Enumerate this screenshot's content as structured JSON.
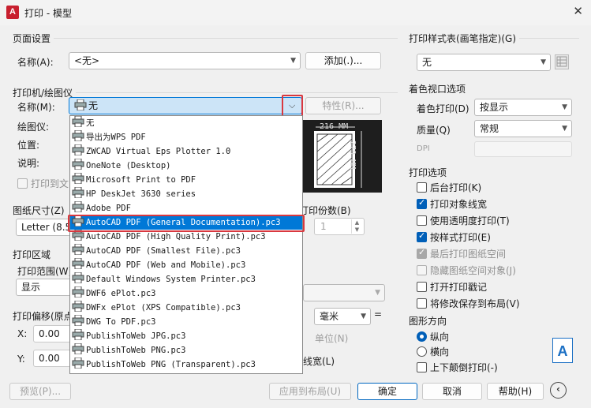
{
  "window": {
    "title": "打印 - 模型",
    "app_icon": "A",
    "close": "✕"
  },
  "page_setup": {
    "group": "页面设置",
    "name_label": "名称(A):",
    "name_value": "<无>",
    "add_button": "添加(.)..."
  },
  "printer": {
    "group": "打印机/绘图仪",
    "name_label": "名称(M):",
    "name_value": "无",
    "props_button": "特性(R)...",
    "plotter_label": "绘图仪:",
    "location_label": "位置:",
    "desc_label": "说明:",
    "print_to_file": "打印到文",
    "dropdown_items": [
      "无",
      "导出为WPS PDF",
      "ZWCAD Virtual Eps Plotter 1.0",
      "OneNote (Desktop)",
      "Microsoft Print to PDF",
      "HP DeskJet 3630 series",
      "Adobe PDF",
      "AutoCAD PDF (General Documentation).pc3",
      "AutoCAD PDF (High Quality Print).pc3",
      "AutoCAD PDF (Smallest File).pc3",
      "AutoCAD PDF (Web and Mobile).pc3",
      "Default Windows System Printer.pc3",
      "DWF6 ePlot.pc3",
      "DWFx ePlot (XPS Compatible).pc3",
      "DWG To PDF.pc3",
      "PublishToWeb JPG.pc3",
      "PublishToWeb PNG.pc3",
      "PublishToWeb PNG (Transparent).pc3"
    ],
    "selected_index": 7
  },
  "preview": {
    "width_label": "216 MM",
    "height_label": "279 MM"
  },
  "paper": {
    "group": "图纸尺寸(Z)",
    "value": "Letter (8.5"
  },
  "copies": {
    "group": "打印份数(B)",
    "value": "1"
  },
  "plot_area": {
    "group": "打印区域",
    "range_label": "打印范围(W)",
    "range_value": "显示"
  },
  "offset": {
    "group": "打印偏移(原点",
    "x_label": "X:",
    "x_value": "0.00",
    "y_label": "Y:",
    "y_value": "0.00",
    "unit_value": "毫米",
    "eq": "=",
    "unit_label": "单位(N)",
    "lineweight": "线宽(L)"
  },
  "style_table": {
    "group": "打印样式表(画笔指定)(G)",
    "value": "无"
  },
  "shaded": {
    "group": "着色视口选项",
    "shade_label": "着色打印(D)",
    "shade_value": "按显示",
    "quality_label": "质量(Q)",
    "quality_value": "常规",
    "dpi_label": "DPI"
  },
  "options": {
    "group": "打印选项",
    "items": [
      {
        "label": "后台打印(K)",
        "checked": false,
        "disabled": false
      },
      {
        "label": "打印对象线宽",
        "checked": true,
        "disabled": false
      },
      {
        "label": "使用透明度打印(T)",
        "checked": false,
        "disabled": false
      },
      {
        "label": "按样式打印(E)",
        "checked": true,
        "disabled": false
      },
      {
        "label": "最后打印图纸空间",
        "checked": true,
        "disabled": true
      },
      {
        "label": "隐藏图纸空间对象(J)",
        "checked": false,
        "disabled": true
      },
      {
        "label": "打开打印戳记",
        "checked": false,
        "disabled": false
      },
      {
        "label": "将修改保存到布局(V)",
        "checked": false,
        "disabled": false
      }
    ]
  },
  "orientation": {
    "group": "图形方向",
    "portrait": "纵向",
    "landscape": "横向",
    "upside": "上下颠倒打印(-)",
    "icon_letter": "A"
  },
  "footer": {
    "preview": "预览(P)...",
    "apply": "应用到布局(U)",
    "ok": "确定",
    "cancel": "取消",
    "help": "帮助(H)"
  }
}
